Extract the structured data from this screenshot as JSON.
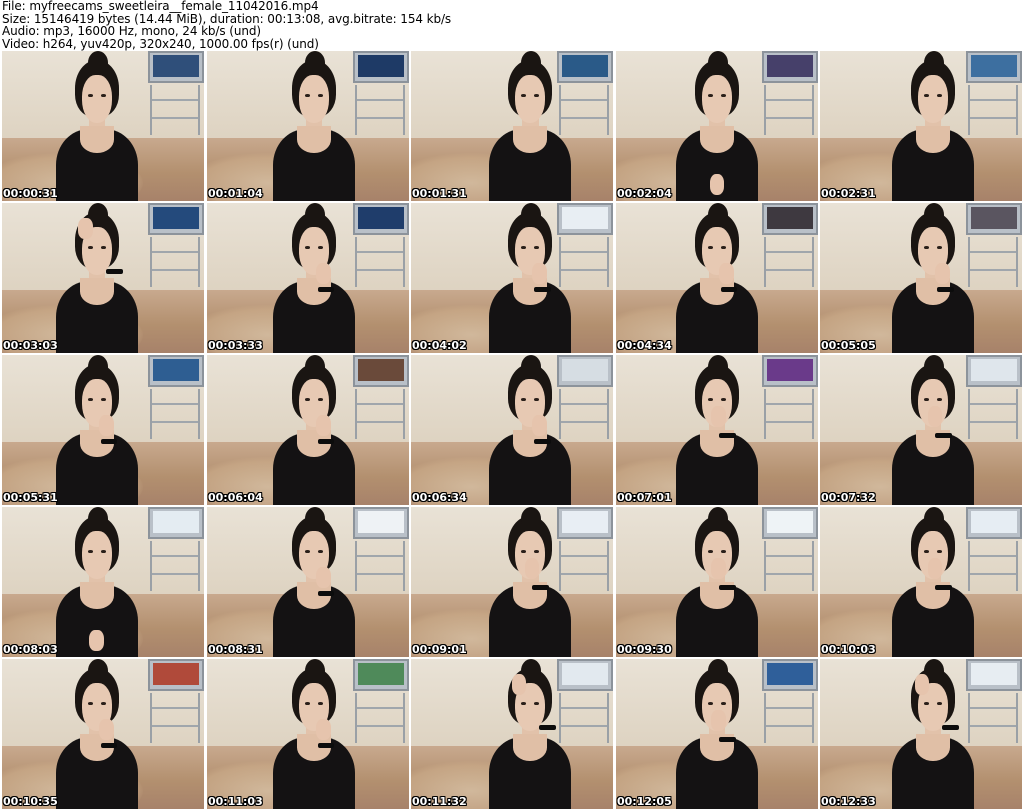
{
  "header": {
    "file_line": "File: myfreecams_sweetleira__female_11042016.mp4",
    "size_line": "Size: 15146419 bytes (14.44 MiB), duration: 00:13:08, avg.bitrate: 154 kb/s",
    "audio_line": "Audio: mp3, 16000 Hz, mono, 24 kb/s (und)",
    "video_line": "Video: h264, yuv420p, 320x240, 1000.00 fps(r) (und)"
  },
  "thumbnails": [
    {
      "timestamp": "00:00:31",
      "screen_color": "#2f4f7a",
      "pose": "down"
    },
    {
      "timestamp": "00:01:04",
      "screen_color": "#1e3a66",
      "pose": "down"
    },
    {
      "timestamp": "00:01:31",
      "screen_color": "#2a5a88",
      "pose": "down"
    },
    {
      "timestamp": "00:02:04",
      "screen_color": "#46406a",
      "pose": "phone"
    },
    {
      "timestamp": "00:02:31",
      "screen_color": "#3d6fa0",
      "pose": "down"
    },
    {
      "timestamp": "00:03:03",
      "screen_color": "#244a7c",
      "pose": "head"
    },
    {
      "timestamp": "00:03:33",
      "screen_color": "#1f3d6b",
      "pose": "chin"
    },
    {
      "timestamp": "00:04:02",
      "screen_color": "#e8eef3",
      "pose": "chin"
    },
    {
      "timestamp": "00:04:34",
      "screen_color": "#3e3940",
      "pose": "chin"
    },
    {
      "timestamp": "00:05:05",
      "screen_color": "#5a5560",
      "pose": "chin"
    },
    {
      "timestamp": "00:05:31",
      "screen_color": "#2e5e92",
      "pose": "chin"
    },
    {
      "timestamp": "00:06:04",
      "screen_color": "#6a4a3a",
      "pose": "chin"
    },
    {
      "timestamp": "00:06:34",
      "screen_color": "#d6dde3",
      "pose": "chin"
    },
    {
      "timestamp": "00:07:01",
      "screen_color": "#6a3a8a",
      "pose": "mouth"
    },
    {
      "timestamp": "00:07:32",
      "screen_color": "#dfe6ec",
      "pose": "mouth"
    },
    {
      "timestamp": "00:08:03",
      "screen_color": "#e4ecf2",
      "pose": "phone"
    },
    {
      "timestamp": "00:08:31",
      "screen_color": "#eef2f5",
      "pose": "chin"
    },
    {
      "timestamp": "00:09:01",
      "screen_color": "#e8eef4",
      "pose": "mouth"
    },
    {
      "timestamp": "00:09:30",
      "screen_color": "#eef3f6",
      "pose": "mouth"
    },
    {
      "timestamp": "00:10:03",
      "screen_color": "#e6edf3",
      "pose": "mouth"
    },
    {
      "timestamp": "00:10:35",
      "screen_color": "#b04a3a",
      "pose": "chin"
    },
    {
      "timestamp": "00:11:03",
      "screen_color": "#4f8a5a",
      "pose": "chin"
    },
    {
      "timestamp": "00:11:32",
      "screen_color": "#e2e9ef",
      "pose": "head"
    },
    {
      "timestamp": "00:12:05",
      "screen_color": "#2f5f9a",
      "pose": "mouth"
    },
    {
      "timestamp": "00:12:33",
      "screen_color": "#e7edf2",
      "pose": "head"
    }
  ],
  "colors": {
    "background": "#ffffff",
    "timestamp_text": "#ffffff",
    "header_text": "#000000"
  }
}
